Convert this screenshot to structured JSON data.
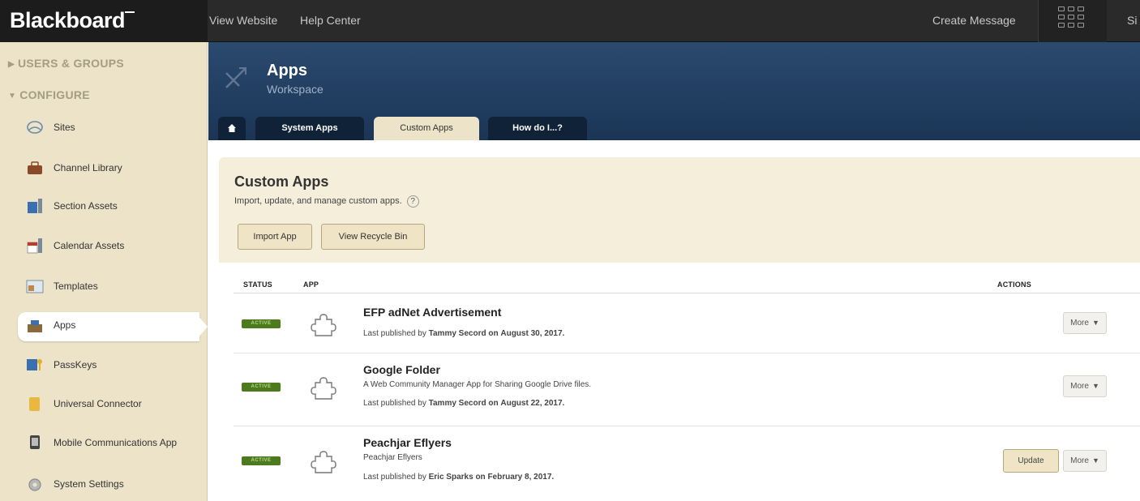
{
  "topbar": {
    "brand": "Blackboard",
    "links": [
      "View Website",
      "Help Center"
    ],
    "create_message": "Create Message",
    "sign_in_partial": "Si"
  },
  "sidebar": {
    "sections": [
      {
        "label": "USERS & GROUPS",
        "collapsed": true
      },
      {
        "label": "CONFIGURE",
        "collapsed": false
      }
    ],
    "items": [
      {
        "label": "Sites",
        "icon": "sites-icon"
      },
      {
        "label": "Channel Library",
        "icon": "channel-library-icon"
      },
      {
        "label": "Section Assets",
        "icon": "section-assets-icon"
      },
      {
        "label": "Calendar Assets",
        "icon": "calendar-assets-icon"
      },
      {
        "label": "Templates",
        "icon": "templates-icon"
      },
      {
        "label": "Apps",
        "icon": "apps-icon",
        "active": true
      },
      {
        "label": "PassKeys",
        "icon": "passkeys-icon"
      },
      {
        "label": "Universal Connector",
        "icon": "universal-connector-icon"
      },
      {
        "label": "Mobile Communications App",
        "icon": "mobile-communications-icon"
      },
      {
        "label": "System Settings",
        "icon": "system-settings-icon"
      }
    ]
  },
  "header": {
    "title": "Apps",
    "subtitle": "Workspace",
    "tabs": [
      {
        "label": "System Apps"
      },
      {
        "label": "Custom Apps",
        "current": true
      },
      {
        "label": "How do I...?"
      }
    ]
  },
  "content": {
    "title": "Custom Apps",
    "description": "Import, update, and manage custom apps.",
    "help": "?",
    "buttons": {
      "import": "Import App",
      "recycle": "View Recycle Bin"
    }
  },
  "table": {
    "headers": {
      "status": "STATUS",
      "app": "APP",
      "actions": "ACTIONS"
    },
    "rows": [
      {
        "status": "ACTIVE",
        "name": "EFP adNet Advertisement",
        "description": "",
        "published_prefix": "Last published by",
        "published_by": "Tammy Secord",
        "published_on_word": "on",
        "published_date": "August 30, 2017.",
        "more": "More"
      },
      {
        "status": "ACTIVE",
        "name": "Google Folder",
        "description": "A Web Community Manager App for Sharing Google Drive files.",
        "published_prefix": "Last published by",
        "published_by": "Tammy Secord",
        "published_on_word": "on",
        "published_date": "August 22, 2017.",
        "more": "More"
      },
      {
        "status": "ACTIVE",
        "name": "Peachjar Eflyers",
        "description": "Peachjar Eflyers",
        "published_prefix": "Last published by",
        "published_by": "Eric Sparks",
        "published_on_word": "on",
        "published_date": "February 8, 2017.",
        "more": "More",
        "update": "Update"
      }
    ]
  },
  "colors": {
    "topbar": "#2a2a2a",
    "sidebar": "#ece3c8",
    "header": "#1f3b5e",
    "badge": "#4e7a1e"
  }
}
